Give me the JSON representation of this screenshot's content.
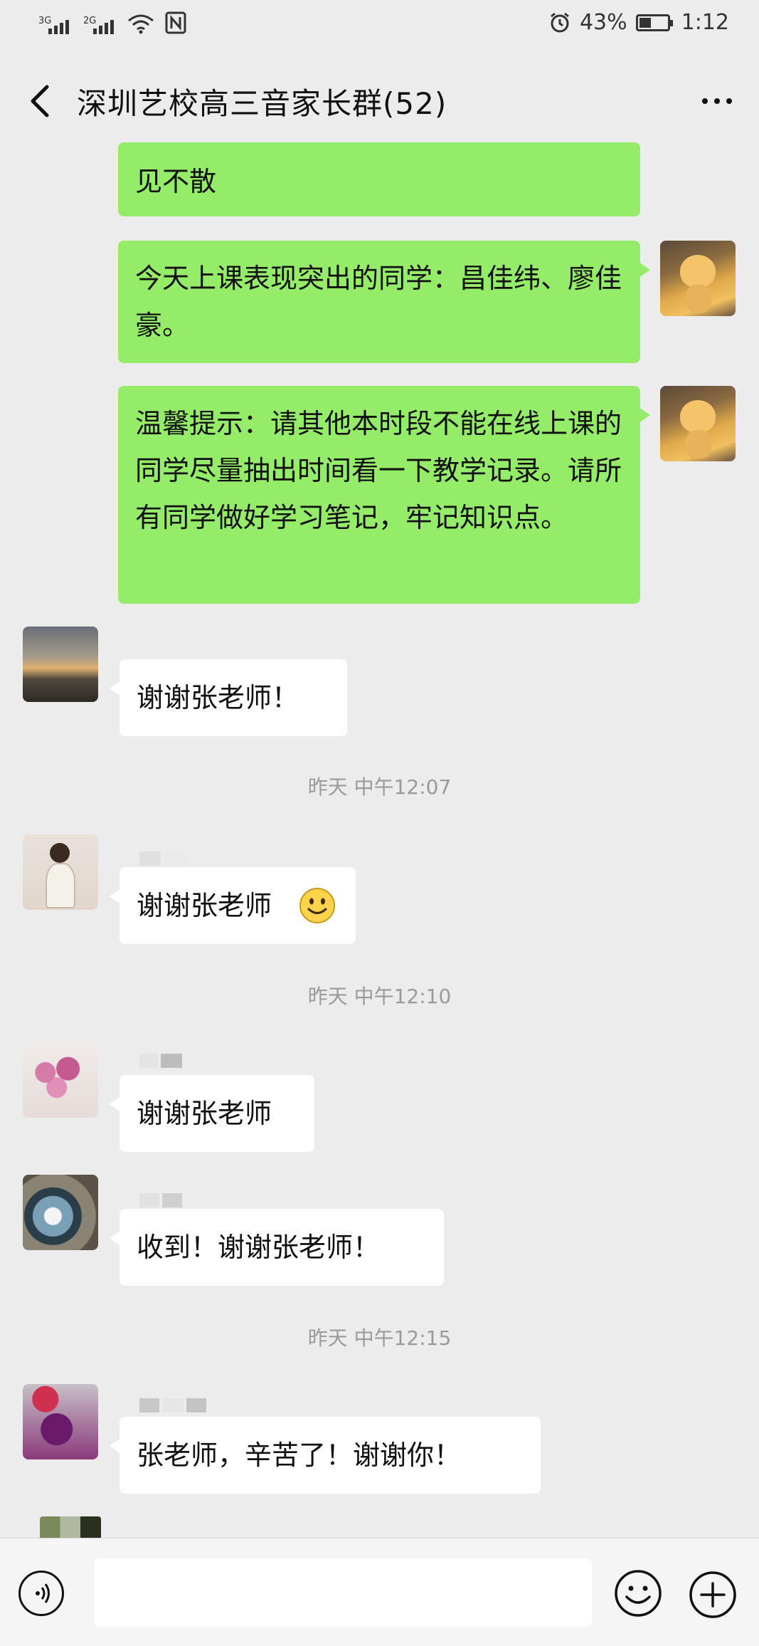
{
  "status_bar": {
    "signal1_tag": "3G",
    "signal2_tag": "2G",
    "battery_percent": "43%",
    "battery_level": 0.43,
    "time": "1:12"
  },
  "header": {
    "title": "深圳艺校高三音家长群(52)"
  },
  "messages": {
    "m0": {
      "text": "见不散"
    },
    "m1": {
      "text": "今天上课表现突出的同学：昌佳纬、廖佳豪。"
    },
    "m2": {
      "text": "温馨提示：请其他本时段不能在线上课的同学尽量抽出时间看一下教学记录。请所有同学做好学习笔记，牢记知识点。"
    },
    "m3": {
      "text": "谢谢张老师！"
    },
    "t1": {
      "text": "昨天 中午12:07"
    },
    "m4": {
      "text": "谢谢张老师"
    },
    "t2": {
      "text": "昨天 中午12:10"
    },
    "m5": {
      "text": "谢谢张老师"
    },
    "m6": {
      "text": "收到！谢谢张老师！"
    },
    "t3": {
      "text": "昨天 中午12:15"
    },
    "m7": {
      "text": "张老师，辛苦了！谢谢你！"
    }
  },
  "icons": {
    "back": "chevron-left-icon",
    "more": "more-dots-icon",
    "voice": "voice-icon",
    "emoji": "smiley-icon",
    "plus": "plus-icon"
  },
  "colors": {
    "background": "#ececec",
    "sent_bubble": "#95ec69",
    "received_bubble": "#ffffff",
    "timestamp": "#9a9a9a"
  }
}
